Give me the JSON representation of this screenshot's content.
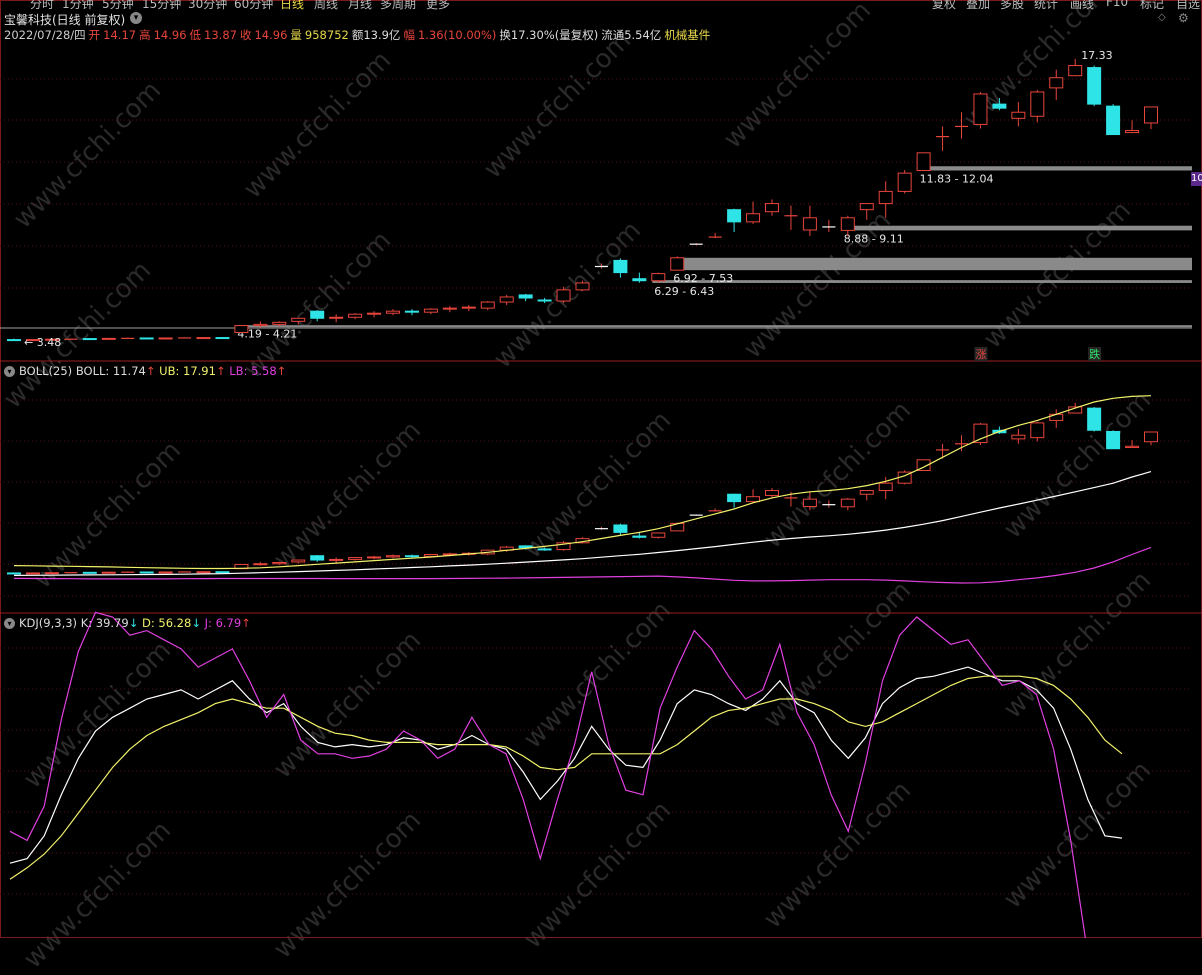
{
  "toolbar": {
    "periods": [
      "分时",
      "1分钟",
      "5分钟",
      "15分钟",
      "30分钟",
      "60分钟",
      "日线",
      "周线",
      "月线",
      "多周期",
      "更多"
    ],
    "active_period": "日线",
    "right": [
      "复权",
      "叠加",
      "多股",
      "统计",
      "画线",
      "F10",
      "标记",
      "自选"
    ]
  },
  "stock": {
    "title": "宝馨科技(日线 前复权)"
  },
  "quote": {
    "date": "2022/07/28/四",
    "open_label": "开",
    "open": "14.17",
    "high_label": "高",
    "high": "14.96",
    "low_label": "低",
    "low": "13.87",
    "close_label": "收",
    "close": "14.96",
    "vol_label": "量",
    "vol": "958752",
    "amount": "额13.9亿",
    "chg_label": "幅",
    "chg": "1.36(10.00%)",
    "turnover": "换17.30%(量复权)",
    "float": "流通5.54亿",
    "industry": "机械基件"
  },
  "edge_badge": "10",
  "colors": {
    "up": "#e8453c",
    "down": "#2fe4e6",
    "boll": "#f2f26a",
    "ub": "#f2f26a",
    "lb": "#e040e0",
    "mid": "#ffffff",
    "k": "#ffffff",
    "d": "#f2f26a",
    "j": "#e040e0",
    "grid": "#5a1010",
    "zone": "#8a8a8a"
  },
  "chart_data": [
    {
      "type": "candlestick",
      "title": "宝馨科技(日线 前复权)",
      "candles": [
        {
          "o": 3.5,
          "h": 3.55,
          "l": 3.46,
          "c": 3.48
        },
        {
          "o": 3.48,
          "h": 3.52,
          "l": 3.46,
          "c": 3.5
        },
        {
          "o": 3.5,
          "h": 3.54,
          "l": 3.48,
          "c": 3.52
        },
        {
          "o": 3.52,
          "h": 3.56,
          "l": 3.5,
          "c": 3.53
        },
        {
          "o": 3.55,
          "h": 3.58,
          "l": 3.51,
          "c": 3.53
        },
        {
          "o": 3.52,
          "h": 3.57,
          "l": 3.5,
          "c": 3.56
        },
        {
          "o": 3.56,
          "h": 3.6,
          "l": 3.53,
          "c": 3.57
        },
        {
          "o": 3.58,
          "h": 3.6,
          "l": 3.55,
          "c": 3.56
        },
        {
          "o": 3.56,
          "h": 3.6,
          "l": 3.54,
          "c": 3.58
        },
        {
          "o": 3.58,
          "h": 3.61,
          "l": 3.56,
          "c": 3.58
        },
        {
          "o": 3.58,
          "h": 3.62,
          "l": 3.56,
          "c": 3.6
        },
        {
          "o": 3.6,
          "h": 3.63,
          "l": 3.57,
          "c": 3.59
        },
        {
          "o": 3.85,
          "h": 4.21,
          "l": 3.85,
          "c": 4.19
        },
        {
          "o": 4.19,
          "h": 4.4,
          "l": 4.1,
          "c": 4.25
        },
        {
          "o": 4.25,
          "h": 4.4,
          "l": 4.15,
          "c": 4.35
        },
        {
          "o": 4.4,
          "h": 4.55,
          "l": 4.25,
          "c": 4.55
        },
        {
          "o": 4.9,
          "h": 4.95,
          "l": 4.4,
          "c": 4.55
        },
        {
          "o": 4.55,
          "h": 4.75,
          "l": 4.35,
          "c": 4.6
        },
        {
          "o": 4.6,
          "h": 4.8,
          "l": 4.5,
          "c": 4.75
        },
        {
          "o": 4.75,
          "h": 4.9,
          "l": 4.6,
          "c": 4.8
        },
        {
          "o": 4.8,
          "h": 5.0,
          "l": 4.7,
          "c": 4.9
        },
        {
          "o": 4.9,
          "h": 5.0,
          "l": 4.7,
          "c": 4.85
        },
        {
          "o": 4.85,
          "h": 5.05,
          "l": 4.75,
          "c": 5.0
        },
        {
          "o": 5.0,
          "h": 5.15,
          "l": 4.85,
          "c": 5.05
        },
        {
          "o": 5.05,
          "h": 5.2,
          "l": 4.9,
          "c": 5.1
        },
        {
          "o": 5.05,
          "h": 5.4,
          "l": 4.95,
          "c": 5.35
        },
        {
          "o": 5.35,
          "h": 5.7,
          "l": 5.2,
          "c": 5.6
        },
        {
          "o": 5.7,
          "h": 5.75,
          "l": 5.4,
          "c": 5.55
        },
        {
          "o": 5.45,
          "h": 5.55,
          "l": 5.3,
          "c": 5.4
        },
        {
          "o": 5.4,
          "h": 6.1,
          "l": 5.3,
          "c": 5.95
        },
        {
          "o": 5.95,
          "h": 6.4,
          "l": 5.9,
          "c": 6.29
        },
        {
          "o": 7.1,
          "h": 7.25,
          "l": 7.0,
          "c": 7.1
        },
        {
          "o": 7.4,
          "h": 7.5,
          "l": 6.55,
          "c": 6.8
        },
        {
          "o": 6.5,
          "h": 6.8,
          "l": 6.3,
          "c": 6.4
        },
        {
          "o": 6.4,
          "h": 6.8,
          "l": 6.29,
          "c": 6.75
        },
        {
          "o": 6.92,
          "h": 7.6,
          "l": 6.92,
          "c": 7.53
        },
        {
          "o": 8.2,
          "h": 8.25,
          "l": 8.15,
          "c": 8.2
        },
        {
          "o": 8.55,
          "h": 8.75,
          "l": 8.5,
          "c": 8.55
        },
        {
          "o": 9.9,
          "h": 9.95,
          "l": 8.8,
          "c": 9.3
        },
        {
          "o": 9.3,
          "h": 10.3,
          "l": 9.2,
          "c": 9.7
        },
        {
          "o": 9.8,
          "h": 10.4,
          "l": 9.6,
          "c": 10.2
        },
        {
          "o": 9.6,
          "h": 10.1,
          "l": 8.9,
          "c": 9.6
        },
        {
          "o": 8.9,
          "h": 10.1,
          "l": 8.6,
          "c": 9.5
        },
        {
          "o": 9.05,
          "h": 9.4,
          "l": 8.8,
          "c": 9.05
        },
        {
          "o": 8.88,
          "h": 9.6,
          "l": 8.6,
          "c": 9.5
        },
        {
          "o": 9.9,
          "h": 10.2,
          "l": 9.4,
          "c": 10.2
        },
        {
          "o": 10.2,
          "h": 11.3,
          "l": 9.5,
          "c": 10.8
        },
        {
          "o": 10.8,
          "h": 11.85,
          "l": 10.7,
          "c": 11.7
        },
        {
          "o": 11.83,
          "h": 12.7,
          "l": 11.8,
          "c": 12.7
        },
        {
          "o": 13.5,
          "h": 14.0,
          "l": 12.8,
          "c": 13.5
        },
        {
          "o": 14.0,
          "h": 14.7,
          "l": 13.4,
          "c": 14.0
        },
        {
          "o": 14.1,
          "h": 15.7,
          "l": 13.9,
          "c": 15.6
        },
        {
          "o": 15.1,
          "h": 15.4,
          "l": 14.8,
          "c": 14.9
        },
        {
          "o": 14.4,
          "h": 15.2,
          "l": 14.0,
          "c": 14.7
        },
        {
          "o": 14.5,
          "h": 15.8,
          "l": 14.2,
          "c": 15.7
        },
        {
          "o": 15.9,
          "h": 16.8,
          "l": 15.3,
          "c": 16.4
        },
        {
          "o": 16.5,
          "h": 17.33,
          "l": 16.5,
          "c": 17.0
        },
        {
          "o": 16.9,
          "h": 17.0,
          "l": 15.0,
          "c": 15.1
        },
        {
          "o": 15.0,
          "h": 15.1,
          "l": 13.6,
          "c": 13.6
        },
        {
          "o": 13.7,
          "h": 14.3,
          "l": 13.7,
          "c": 13.8
        },
        {
          "o": 14.17,
          "h": 14.96,
          "l": 13.87,
          "c": 14.96
        }
      ],
      "price_labels": [
        {
          "i": 0,
          "v": 3.48,
          "text": "← 3.48"
        },
        {
          "i": 56,
          "v": 17.33,
          "text": "17.33"
        }
      ],
      "zones": [
        {
          "lo": 4.19,
          "hi": 4.21,
          "from": 12,
          "text": "4.19 - 4.21"
        },
        {
          "lo": 6.29,
          "hi": 6.43,
          "from": 34,
          "text": "6.29 - 6.43"
        },
        {
          "lo": 6.92,
          "hi": 7.53,
          "from": 35,
          "text": "6.92 - 7.53"
        },
        {
          "lo": 8.88,
          "hi": 9.11,
          "from": 44,
          "text": "8.88 - 9.11"
        },
        {
          "lo": 11.83,
          "hi": 12.04,
          "from": 48,
          "text": "11.83 - 12.04"
        }
      ],
      "markers": [
        {
          "i": 51,
          "text": "涨",
          "color": "#e8453c"
        },
        {
          "i": 57,
          "text": "跌",
          "color": "#2fe46a"
        }
      ]
    },
    {
      "type": "line",
      "title": "BOLL(25)",
      "legend": [
        {
          "name": "BOLL",
          "value": "11.74",
          "arrow": "↑"
        },
        {
          "name": "UB",
          "value": "17.91",
          "arrow": "↑"
        },
        {
          "name": "LB",
          "value": "5.58",
          "arrow": "↑"
        }
      ],
      "series": [
        {
          "name": "UB",
          "values": [
            4.1,
            4.08,
            4.06,
            4.04,
            4.02,
            3.99,
            3.96,
            3.93,
            3.9,
            3.88,
            3.86,
            3.86,
            3.88,
            3.92,
            4.0,
            4.1,
            4.2,
            4.3,
            4.4,
            4.5,
            4.6,
            4.7,
            4.8,
            4.92,
            5.04,
            5.18,
            5.34,
            5.5,
            5.66,
            5.84,
            6.04,
            6.3,
            6.55,
            6.8,
            7.1,
            7.5,
            7.9,
            8.3,
            8.7,
            9.2,
            9.6,
            9.9,
            10.1,
            10.2,
            10.35,
            10.6,
            10.95,
            11.4,
            12.1,
            12.9,
            13.7,
            14.4,
            15.0,
            15.5,
            15.9,
            16.4,
            16.9,
            17.4,
            17.7,
            17.85,
            17.91
          ]
        },
        {
          "name": "BOLL",
          "values": [
            3.3,
            3.31,
            3.32,
            3.33,
            3.34,
            3.35,
            3.36,
            3.37,
            3.38,
            3.4,
            3.42,
            3.44,
            3.48,
            3.52,
            3.56,
            3.61,
            3.66,
            3.71,
            3.76,
            3.82,
            3.88,
            3.94,
            4.0,
            4.07,
            4.14,
            4.21,
            4.29,
            4.38,
            4.47,
            4.56,
            4.66,
            4.78,
            4.9,
            5.02,
            5.16,
            5.32,
            5.48,
            5.64,
            5.82,
            6.0,
            6.16,
            6.3,
            6.42,
            6.52,
            6.64,
            6.8,
            6.98,
            7.2,
            7.46,
            7.76,
            8.1,
            8.44,
            8.78,
            9.1,
            9.42,
            9.76,
            10.1,
            10.44,
            10.8,
            11.3,
            11.74
          ]
        },
        {
          "name": "LB",
          "values": [
            3.06,
            3.05,
            3.04,
            3.03,
            3.02,
            3.02,
            3.02,
            3.02,
            3.02,
            3.03,
            3.04,
            3.05,
            3.05,
            3.05,
            3.05,
            3.05,
            3.05,
            3.04,
            3.04,
            3.04,
            3.04,
            3.04,
            3.04,
            3.05,
            3.06,
            3.07,
            3.08,
            3.1,
            3.12,
            3.14,
            3.16,
            3.18,
            3.2,
            3.22,
            3.24,
            3.18,
            3.1,
            3.0,
            2.9,
            2.85,
            2.85,
            2.88,
            2.92,
            2.95,
            2.95,
            2.95,
            2.92,
            2.85,
            2.78,
            2.72,
            2.68,
            2.7,
            2.8,
            2.95,
            3.1,
            3.3,
            3.55,
            3.9,
            4.4,
            5.0,
            5.58
          ]
        }
      ]
    },
    {
      "type": "line",
      "title": "KDJ(9,3,3)",
      "legend": [
        {
          "name": "K",
          "value": "39.79",
          "arrow": "↓"
        },
        {
          "name": "D",
          "value": "56.28",
          "arrow": "↓"
        },
        {
          "name": "J",
          "value": "6.79",
          "arrow": "↑"
        }
      ],
      "ylim": [
        -10,
        110
      ],
      "series": [
        {
          "name": "K",
          "values": [
            10,
            12,
            22,
            40,
            56,
            68,
            74,
            78,
            82,
            84,
            86,
            82,
            86,
            90,
            82,
            76,
            80,
            70,
            63,
            61,
            62,
            61,
            62,
            65,
            64,
            60,
            62,
            66,
            62,
            60,
            50,
            38,
            46,
            56,
            70,
            60,
            53,
            52,
            64,
            80,
            86,
            84,
            80,
            77,
            82,
            90,
            80,
            76,
            64,
            56,
            65,
            80,
            87,
            91,
            92,
            94,
            96,
            93,
            90,
            90,
            86,
            78,
            60,
            38,
            22,
            21
          ]
        },
        {
          "name": "D",
          "values": [
            3,
            8,
            14,
            22,
            32,
            42,
            52,
            60,
            66,
            70,
            73,
            76,
            80,
            82,
            80,
            78,
            78,
            74,
            70,
            67,
            66,
            64,
            63,
            63,
            63,
            62,
            62,
            62,
            62,
            61,
            57,
            52,
            51,
            52,
            58,
            58,
            58,
            58,
            58,
            62,
            68,
            74,
            77,
            78,
            80,
            82,
            82,
            80,
            77,
            72,
            70,
            72,
            76,
            80,
            84,
            88,
            91,
            92,
            92,
            92,
            91,
            88,
            82,
            74,
            64,
            58
          ]
        },
        {
          "name": "J",
          "values": [
            24,
            20,
            35,
            73,
            103,
            120,
            118,
            110,
            112,
            108,
            104,
            96,
            100,
            104,
            90,
            74,
            84,
            64,
            58,
            58,
            56,
            57,
            60,
            68,
            64,
            56,
            60,
            74,
            62,
            58,
            38,
            12,
            38,
            62,
            94,
            62,
            42,
            40,
            78,
            96,
            112,
            104,
            92,
            82,
            86,
            106,
            76,
            62,
            40,
            24,
            54,
            90,
            110,
            118,
            112,
            106,
            108,
            98,
            88,
            90,
            84,
            60,
            20,
            -30,
            -55,
            -40
          ]
        }
      ]
    }
  ]
}
